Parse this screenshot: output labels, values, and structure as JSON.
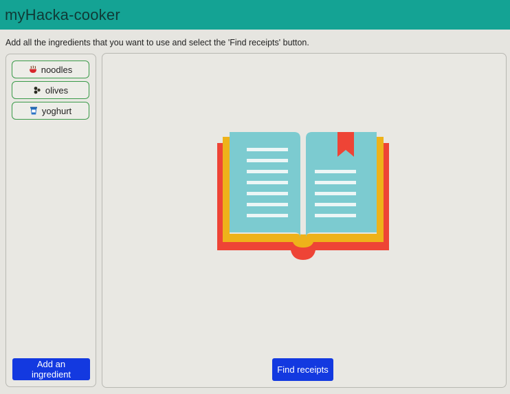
{
  "app": {
    "title": "myHacka-cooker"
  },
  "instructions": "Add all the ingredients that you want to use and select the 'Find receipts' button.",
  "ingredients": [
    {
      "label": "noodles",
      "icon": "noodle-bowl-icon"
    },
    {
      "label": "olives",
      "icon": "olives-icon"
    },
    {
      "label": "yoghurt",
      "icon": "yoghurt-cup-icon"
    }
  ],
  "actions": {
    "add_label": "Add an ingredient",
    "find_label": "Find receipts"
  },
  "illustration": {
    "icon": "open-book-icon"
  },
  "colors": {
    "header": "#14a394",
    "primary_button": "#1339e0",
    "chip_border": "#3a9a49",
    "book_pages": "#7ccbd0",
    "book_cover_red": "#ee4436",
    "book_cover_yellow": "#eeb21a"
  }
}
